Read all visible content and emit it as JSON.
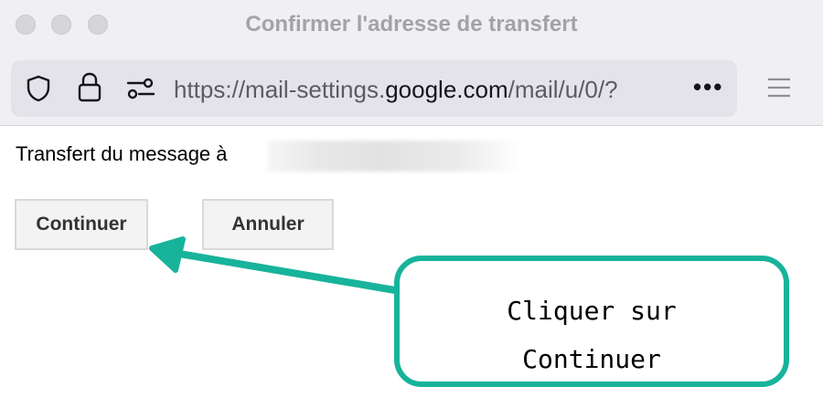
{
  "window": {
    "title": "Confirmer l'adresse de transfert"
  },
  "browser": {
    "url_prefix": "https://mail-settings.",
    "url_domain": "google.com",
    "url_path": "/mail/u/0/?",
    "more_label": "•••"
  },
  "content": {
    "message_label": "Transfert du message à",
    "continue_label": "Continuer",
    "cancel_label": "Annuler"
  },
  "annotation": {
    "line1": "Cliquer sur",
    "line2": "Continuer",
    "color": "#17b39b"
  }
}
